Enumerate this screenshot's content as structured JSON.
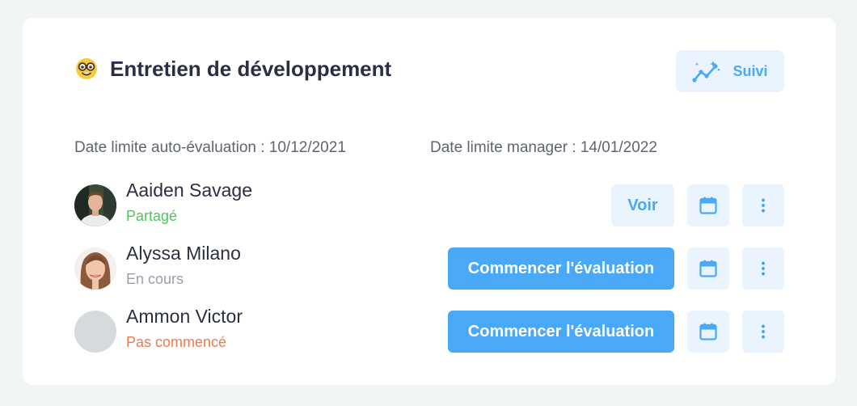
{
  "header": {
    "title": "Entretien de développement",
    "emoji_icon": "nerd-face-emoji-icon",
    "suivi_label": "Suivi",
    "suivi_icon": "trend-sparkle-icon"
  },
  "deadlines": {
    "self_eval": "Date limite auto-évaluation : 10/12/2021",
    "manager": "Date limite manager : 14/01/2022"
  },
  "colors": {
    "accent": "#4aa8f8",
    "accent_light": "#e9f4fe",
    "status_shared": "#55c35b",
    "status_in_progress": "#9a9ea8",
    "status_not_started": "#f07a4a"
  },
  "rows": [
    {
      "name": "Aaiden Savage",
      "status": "Partagé",
      "action_label": "Voir",
      "avatar": "photo"
    },
    {
      "name": "Alyssa Milano",
      "status": "En cours",
      "action_label": "Commencer l'évaluation",
      "avatar": "photo"
    },
    {
      "name": "Ammon Victor",
      "status": "Pas commencé",
      "action_label": "Commencer l'évaluation",
      "avatar": "placeholder"
    }
  ],
  "icons": {
    "calendar": "calendar-icon",
    "more": "more-vertical-icon"
  }
}
